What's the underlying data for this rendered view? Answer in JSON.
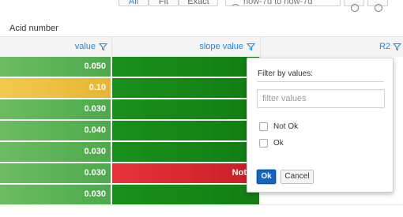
{
  "toolbar": {
    "buttons": [
      "All",
      "Fit",
      "Exact"
    ],
    "date_range": "now-7d to now-7d",
    "active_button": 0
  },
  "table": {
    "title": "Acid number",
    "columns": [
      {
        "label": "value"
      },
      {
        "label": "slope value"
      },
      {
        "label": "R2"
      }
    ],
    "rows": [
      {
        "value": "0.050",
        "value_status": "green-light",
        "slope": "",
        "slope_status": "green-dark"
      },
      {
        "value": "0.10",
        "value_status": "yellow",
        "slope": "",
        "slope_status": "green-dark"
      },
      {
        "value": "0.030",
        "value_status": "green-light",
        "slope": "",
        "slope_status": "green-dark"
      },
      {
        "value": "0.040",
        "value_status": "green-light",
        "slope": "",
        "slope_status": "green-dark"
      },
      {
        "value": "0.030",
        "value_status": "green-light",
        "slope": "",
        "slope_status": "green-dark"
      },
      {
        "value": "0.030",
        "value_status": "green-light",
        "slope": "Not",
        "slope_status": "red"
      },
      {
        "value": "0.030",
        "value_status": "green-light",
        "slope": "",
        "slope_status": "green-dark"
      }
    ]
  },
  "filter_popup": {
    "title": "Filter by values:",
    "input_placeholder": "filter values",
    "input_value": "",
    "options": [
      {
        "label": "Not Ok",
        "checked": false
      },
      {
        "label": "Ok",
        "checked": false
      }
    ],
    "ok_label": "Ok",
    "cancel_label": "Cancel"
  },
  "colors": {
    "accent": "#1e88e5",
    "green_light": "#5cb356",
    "green_dark": "#168616",
    "yellow": "#ecbf40",
    "red": "#d8282f",
    "ok_button": "#1565c0"
  }
}
